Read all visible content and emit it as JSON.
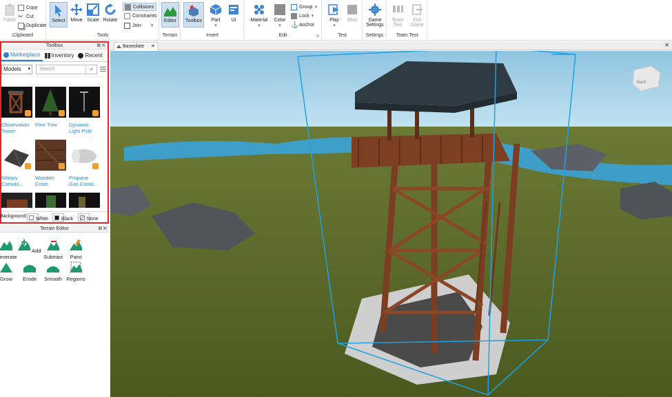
{
  "ribbon": {
    "clipboard": {
      "paste": "Paste",
      "copy": "Copy",
      "cut": "Cut",
      "duplicate": "Duplicate",
      "label": "Clipboard"
    },
    "tools": {
      "select": "Select",
      "move": "Move",
      "scale": "Scale",
      "rotate": "Rotate",
      "collisions": "Collisions",
      "constraints": "Constraints",
      "join": "Join",
      "label": "Tools"
    },
    "terrain": {
      "editor": "Editor",
      "label": "Terrain"
    },
    "insert": {
      "toolbox": "Toolbox",
      "part": "Part",
      "ui": "UI",
      "label": "Insert"
    },
    "edit": {
      "material": "Material",
      "color": "Color",
      "group": "Group",
      "lock": "Lock",
      "anchor": "Anchor",
      "label": "Edit"
    },
    "test": {
      "play": "Play",
      "stop": "Stop",
      "label": "Test"
    },
    "settings": {
      "game_settings_1": "Game",
      "game_settings_2": "Settings",
      "label": "Settings"
    },
    "team_test": {
      "team_test_1": "Team",
      "team_test_2": "Test",
      "exit_game_1": "Exit",
      "exit_game_2": "Game",
      "label": "Team Test"
    }
  },
  "toolbox": {
    "title": "Toolbox",
    "tabs": [
      "Marketplace",
      "Inventory",
      "Recent"
    ],
    "category": "Models",
    "search_placeholder": "Search",
    "items": [
      {
        "line1": "Observation",
        "line2": "Tower"
      },
      {
        "line1": "Pine Tree",
        "line2": ""
      },
      {
        "line1": "Dynamic",
        "line2": "Light Pole"
      },
      {
        "line1": "Military",
        "line2": "Canvas..."
      },
      {
        "line1": "Wooden",
        "line2": "Crate"
      },
      {
        "line1": "Propane",
        "line2": "Gas Conta..."
      }
    ],
    "background_label": "Background:",
    "bg_options": [
      "White",
      "Black",
      "None"
    ]
  },
  "terrain_editor": {
    "title": "Terrain Editor",
    "tools": [
      "Generate",
      "Add",
      "Subtract",
      "Paint",
      "Grow",
      "Erode",
      "Smooth",
      "Regions"
    ]
  },
  "document": {
    "tab": "Baseplate"
  },
  "viewcube": {
    "label": "Back"
  },
  "colors": {
    "accent": "#2f7cc7",
    "highlight_border": "#e0262f",
    "selection_box": "#1fa0e8",
    "sky": "#a9d4ea",
    "grass": "#5b6b2c"
  }
}
